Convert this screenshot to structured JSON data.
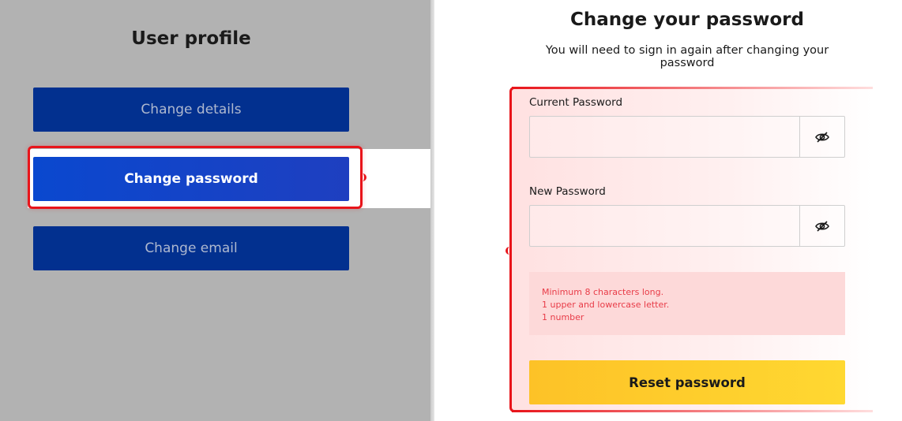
{
  "profile_nav": {
    "title": "User profile",
    "items": [
      {
        "label": "Change details",
        "active": false
      },
      {
        "label": "Change password",
        "active": true
      },
      {
        "label": "Change email",
        "active": false
      }
    ]
  },
  "password_form": {
    "title": "Change your password",
    "subtitle": "You will need to sign in again after changing your password",
    "current_password": {
      "label": "Current Password",
      "value": "",
      "toggle_icon": "eye-off-icon"
    },
    "new_password": {
      "label": "New Password",
      "value": "",
      "toggle_icon": "eye-off-icon"
    },
    "requirements": [
      "Minimum 8 characters long.",
      "1 upper and lowercase letter.",
      "1 number"
    ],
    "submit_label": "Reset password"
  },
  "colors": {
    "nav_inactive": "#02308f",
    "nav_active": "#0a48cf",
    "highlight_red": "#e8141a",
    "requirement_text": "#e83c48",
    "requirement_bg": "#fdd9d9",
    "submit_bg": "#fdc227"
  }
}
